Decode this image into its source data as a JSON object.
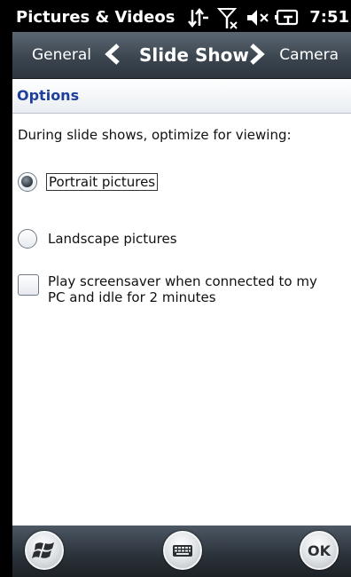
{
  "statusbar": {
    "title": "Pictures & Videos",
    "time": "7:51",
    "icons": [
      "data-sync-icon",
      "no-signal-icon",
      "speaker-muted-icon",
      "battery-charging-icon"
    ]
  },
  "tabs": {
    "previous": "General",
    "current": "Slide Show",
    "next": "Camera"
  },
  "section": {
    "title": "Options",
    "description": "During slide shows, optimize for viewing:"
  },
  "options": [
    {
      "type": "radio",
      "label": "Portrait pictures",
      "checked": true
    },
    {
      "type": "radio",
      "label": "Landscape pictures",
      "checked": false
    },
    {
      "type": "checkbox",
      "label": "Play screensaver when connected to my PC and idle for 2 minutes",
      "checked": false
    }
  ],
  "bottombar": {
    "start_icon": "windows-start-icon",
    "keyboard_icon": "keyboard-icon",
    "ok_label": "OK"
  },
  "colors": {
    "section_title": "#1f3f9b",
    "background": "#000000",
    "content": "#ffffff"
  }
}
